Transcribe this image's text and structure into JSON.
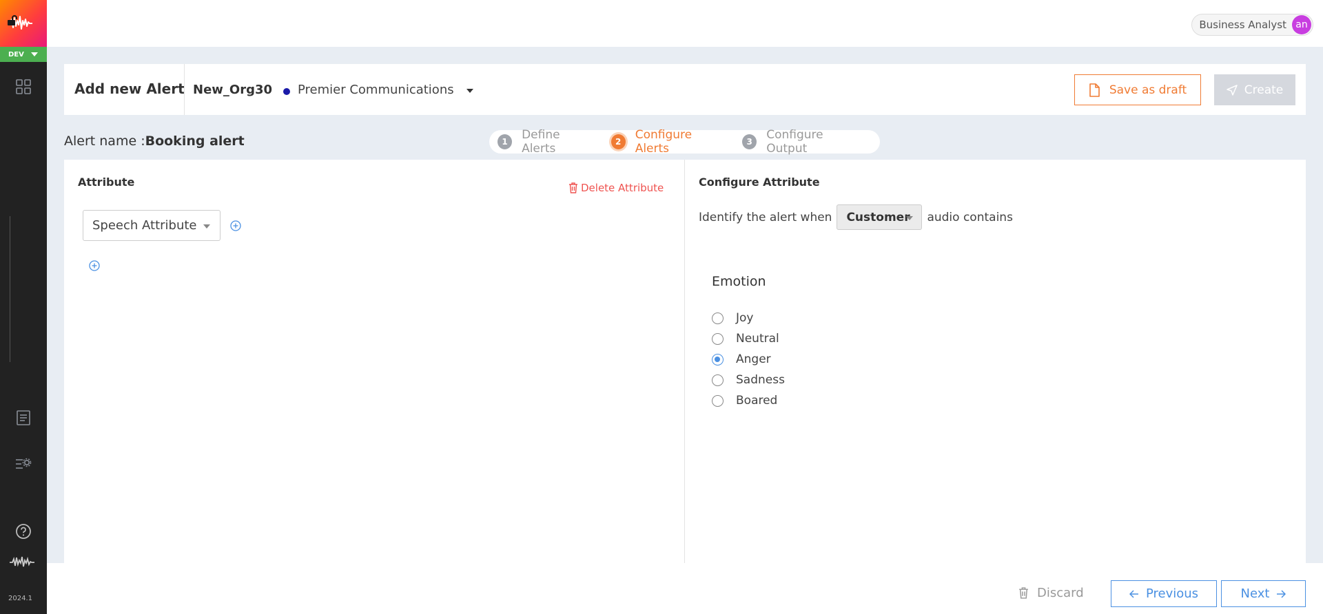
{
  "app": {
    "environment": "DEV",
    "version": "2024.1",
    "colors": {
      "accent": "#f07b33",
      "link": "#4a90e2",
      "danger": "#ef5350",
      "sidebar": "#222222"
    }
  },
  "user": {
    "role": "Business Analyst",
    "initials": "an"
  },
  "header": {
    "title": "Add new Alert",
    "org_name": "New_Org30",
    "company": "Premier Communications",
    "save_draft_label": "Save as draft",
    "create_label": "Create"
  },
  "alert": {
    "name_label": "Alert name :",
    "name_value": "Booking alert"
  },
  "stepper": {
    "steps": [
      {
        "num": "1",
        "label": "Define Alerts",
        "state": "done"
      },
      {
        "num": "2",
        "label": "Configure Alerts",
        "state": "active"
      },
      {
        "num": "3",
        "label": "Configure Output",
        "state": "pending"
      }
    ]
  },
  "attribute_panel": {
    "title": "Attribute",
    "delete_label": "Delete Attribute",
    "selected_attribute": "Speech Attribute"
  },
  "config_panel": {
    "title": "Configure Attribute",
    "identify_prefix": "Identify the alert when",
    "speaker": "Customer",
    "identify_suffix": "audio contains",
    "emotion_title": "Emotion",
    "emotions": [
      "Joy",
      "Neutral",
      "Anger",
      "Sadness",
      "Boared"
    ],
    "selected_emotion": "Anger"
  },
  "footer": {
    "discard_label": "Discard",
    "previous_label": "Previous",
    "next_label": "Next"
  }
}
